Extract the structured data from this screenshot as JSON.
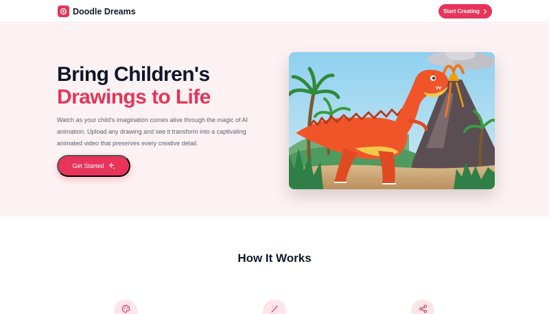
{
  "app": {
    "brand": "Doodle Dreams",
    "brand_color": "#e8345a"
  },
  "nav": {
    "cta_label": "Start Creating",
    "cta_icon": "chevron-right-icon"
  },
  "hero": {
    "title_line1": "Bring Children's",
    "title_line2": "Drawings to Life",
    "description": "Watch as your child's imagination comes alive through the magic of AI animation. Upload any drawing and see it transform into a captivating animated video that preserves every creative detail.",
    "cta_label": "Get Started",
    "cta_icon": "sparkles-icon",
    "image_subject": "illustration of orange dinosaur with erupting volcano and palm trees"
  },
  "how_it_works": {
    "title": "How It Works",
    "steps": [
      {
        "icon": "palette-icon"
      },
      {
        "icon": "magic-wand-icon"
      },
      {
        "icon": "share-icon"
      }
    ]
  },
  "colors": {
    "accent": "#e8345a",
    "hero_bg": "#fdf2f3",
    "heading": "#0f172a",
    "body_text": "#5b6170",
    "icon_bg": "#fde5ea"
  }
}
